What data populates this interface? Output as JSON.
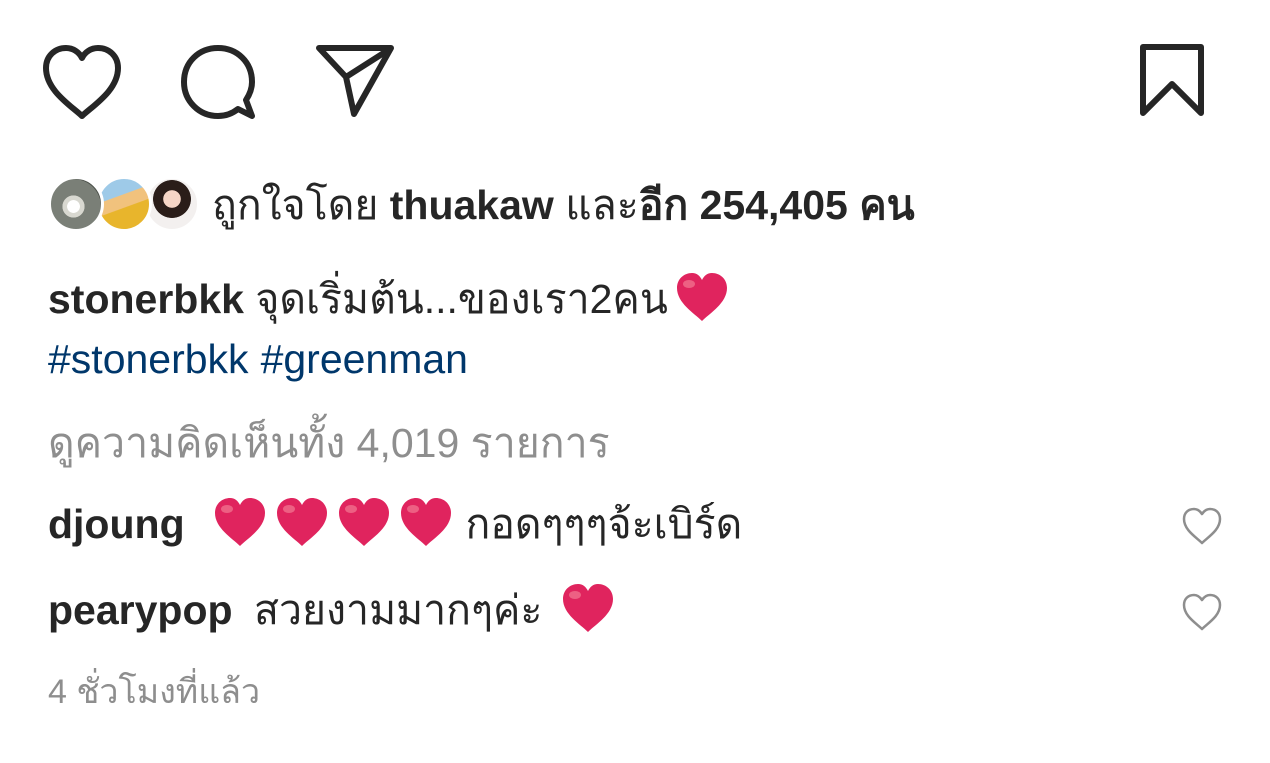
{
  "actions": {
    "like_icon": "heart-outline",
    "comment_icon": "speech-bubble",
    "share_icon": "paper-plane",
    "save_icon": "bookmark"
  },
  "likes": {
    "prefix": "ถูกใจโดย ",
    "user": "thuakaw",
    "middle": " และ",
    "count_text": "อีก 254,405 คน"
  },
  "caption": {
    "username": "stonerbkk",
    "text": "จุดเริ่มต้น...ของเรา2คน",
    "emoji": "red-heart",
    "hashtags": [
      "#stonerbkk",
      "#greenman"
    ]
  },
  "view_all_comments": "ดูความคิดเห็นทั้ง 4,019 รายการ",
  "comments": [
    {
      "username": "djoung",
      "hearts_before": 4,
      "text": "กอดๆๆๆจ้ะเบิร์ด"
    },
    {
      "username": "pearypop",
      "text": "สวยงามมากๆค่ะ",
      "hearts_after": 1
    }
  ],
  "timestamp": "4 ชั่วโมงที่แล้ว",
  "colors": {
    "text": "#262626",
    "hashtag": "#00376b",
    "muted": "#8e8e8e",
    "heart": "#e0245e"
  }
}
